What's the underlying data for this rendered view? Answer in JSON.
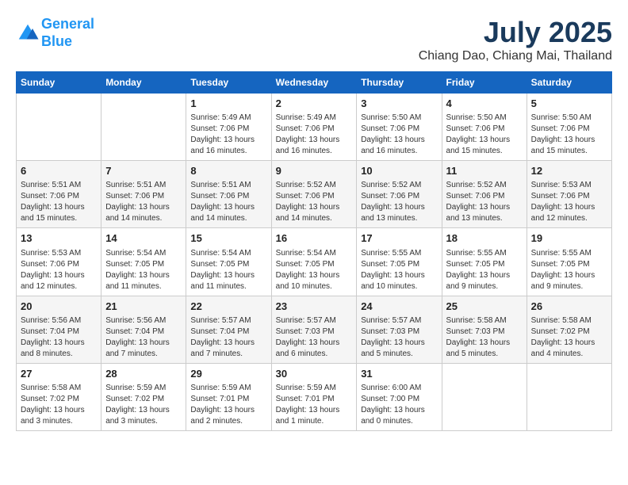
{
  "header": {
    "logo_line1": "General",
    "logo_line2": "Blue",
    "month": "July 2025",
    "location": "Chiang Dao, Chiang Mai, Thailand"
  },
  "days_of_week": [
    "Sunday",
    "Monday",
    "Tuesday",
    "Wednesday",
    "Thursday",
    "Friday",
    "Saturday"
  ],
  "weeks": [
    [
      {
        "day": "",
        "info": ""
      },
      {
        "day": "",
        "info": ""
      },
      {
        "day": "1",
        "info": "Sunrise: 5:49 AM\nSunset: 7:06 PM\nDaylight: 13 hours\nand 16 minutes."
      },
      {
        "day": "2",
        "info": "Sunrise: 5:49 AM\nSunset: 7:06 PM\nDaylight: 13 hours\nand 16 minutes."
      },
      {
        "day": "3",
        "info": "Sunrise: 5:50 AM\nSunset: 7:06 PM\nDaylight: 13 hours\nand 16 minutes."
      },
      {
        "day": "4",
        "info": "Sunrise: 5:50 AM\nSunset: 7:06 PM\nDaylight: 13 hours\nand 15 minutes."
      },
      {
        "day": "5",
        "info": "Sunrise: 5:50 AM\nSunset: 7:06 PM\nDaylight: 13 hours\nand 15 minutes."
      }
    ],
    [
      {
        "day": "6",
        "info": "Sunrise: 5:51 AM\nSunset: 7:06 PM\nDaylight: 13 hours\nand 15 minutes."
      },
      {
        "day": "7",
        "info": "Sunrise: 5:51 AM\nSunset: 7:06 PM\nDaylight: 13 hours\nand 14 minutes."
      },
      {
        "day": "8",
        "info": "Sunrise: 5:51 AM\nSunset: 7:06 PM\nDaylight: 13 hours\nand 14 minutes."
      },
      {
        "day": "9",
        "info": "Sunrise: 5:52 AM\nSunset: 7:06 PM\nDaylight: 13 hours\nand 14 minutes."
      },
      {
        "day": "10",
        "info": "Sunrise: 5:52 AM\nSunset: 7:06 PM\nDaylight: 13 hours\nand 13 minutes."
      },
      {
        "day": "11",
        "info": "Sunrise: 5:52 AM\nSunset: 7:06 PM\nDaylight: 13 hours\nand 13 minutes."
      },
      {
        "day": "12",
        "info": "Sunrise: 5:53 AM\nSunset: 7:06 PM\nDaylight: 13 hours\nand 12 minutes."
      }
    ],
    [
      {
        "day": "13",
        "info": "Sunrise: 5:53 AM\nSunset: 7:06 PM\nDaylight: 13 hours\nand 12 minutes."
      },
      {
        "day": "14",
        "info": "Sunrise: 5:54 AM\nSunset: 7:05 PM\nDaylight: 13 hours\nand 11 minutes."
      },
      {
        "day": "15",
        "info": "Sunrise: 5:54 AM\nSunset: 7:05 PM\nDaylight: 13 hours\nand 11 minutes."
      },
      {
        "day": "16",
        "info": "Sunrise: 5:54 AM\nSunset: 7:05 PM\nDaylight: 13 hours\nand 10 minutes."
      },
      {
        "day": "17",
        "info": "Sunrise: 5:55 AM\nSunset: 7:05 PM\nDaylight: 13 hours\nand 10 minutes."
      },
      {
        "day": "18",
        "info": "Sunrise: 5:55 AM\nSunset: 7:05 PM\nDaylight: 13 hours\nand 9 minutes."
      },
      {
        "day": "19",
        "info": "Sunrise: 5:55 AM\nSunset: 7:05 PM\nDaylight: 13 hours\nand 9 minutes."
      }
    ],
    [
      {
        "day": "20",
        "info": "Sunrise: 5:56 AM\nSunset: 7:04 PM\nDaylight: 13 hours\nand 8 minutes."
      },
      {
        "day": "21",
        "info": "Sunrise: 5:56 AM\nSunset: 7:04 PM\nDaylight: 13 hours\nand 7 minutes."
      },
      {
        "day": "22",
        "info": "Sunrise: 5:57 AM\nSunset: 7:04 PM\nDaylight: 13 hours\nand 7 minutes."
      },
      {
        "day": "23",
        "info": "Sunrise: 5:57 AM\nSunset: 7:03 PM\nDaylight: 13 hours\nand 6 minutes."
      },
      {
        "day": "24",
        "info": "Sunrise: 5:57 AM\nSunset: 7:03 PM\nDaylight: 13 hours\nand 5 minutes."
      },
      {
        "day": "25",
        "info": "Sunrise: 5:58 AM\nSunset: 7:03 PM\nDaylight: 13 hours\nand 5 minutes."
      },
      {
        "day": "26",
        "info": "Sunrise: 5:58 AM\nSunset: 7:02 PM\nDaylight: 13 hours\nand 4 minutes."
      }
    ],
    [
      {
        "day": "27",
        "info": "Sunrise: 5:58 AM\nSunset: 7:02 PM\nDaylight: 13 hours\nand 3 minutes."
      },
      {
        "day": "28",
        "info": "Sunrise: 5:59 AM\nSunset: 7:02 PM\nDaylight: 13 hours\nand 3 minutes."
      },
      {
        "day": "29",
        "info": "Sunrise: 5:59 AM\nSunset: 7:01 PM\nDaylight: 13 hours\nand 2 minutes."
      },
      {
        "day": "30",
        "info": "Sunrise: 5:59 AM\nSunset: 7:01 PM\nDaylight: 13 hours\nand 1 minute."
      },
      {
        "day": "31",
        "info": "Sunrise: 6:00 AM\nSunset: 7:00 PM\nDaylight: 13 hours\nand 0 minutes."
      },
      {
        "day": "",
        "info": ""
      },
      {
        "day": "",
        "info": ""
      }
    ]
  ]
}
